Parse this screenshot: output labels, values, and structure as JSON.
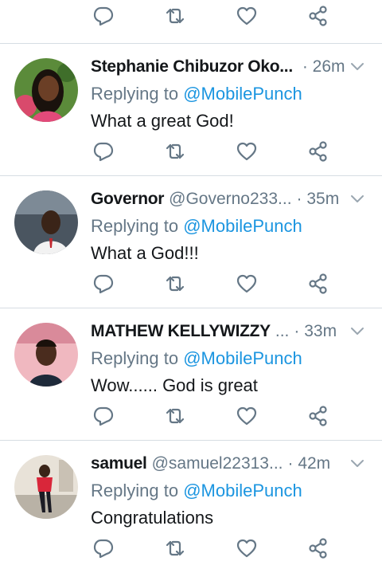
{
  "icons": {
    "reply": "reply-icon",
    "retweet": "retweet-icon",
    "like": "heart-icon",
    "share": "share-icon",
    "caret": "chevron-down-icon"
  },
  "colors": {
    "text": "#14171a",
    "muted": "#657786",
    "link": "#1b95e0",
    "divider": "#d6dde3"
  },
  "tweets": [
    {
      "name": "Stephanie Chibuzor Oko...",
      "handle": "",
      "time": "· 26m",
      "replying_prefix": "Replying to",
      "replying_to": "@MobilePunch",
      "text": "What a great God!"
    },
    {
      "name": "Governor",
      "handle": "@Governo233...",
      "time": "· 35m",
      "replying_prefix": "Replying to",
      "replying_to": "@MobilePunch",
      "text": "What a God!!!"
    },
    {
      "name": "MATHEW KELLYWIZZY",
      "handle": "...",
      "time": "· 33m",
      "replying_prefix": "Replying to",
      "replying_to": "@MobilePunch",
      "text": "Wow...... God is great"
    },
    {
      "name": "samuel",
      "handle": "@samuel22313...",
      "time": "· 42m",
      "replying_prefix": "Replying to",
      "replying_to": "@MobilePunch",
      "text": "Congratulations"
    }
  ]
}
